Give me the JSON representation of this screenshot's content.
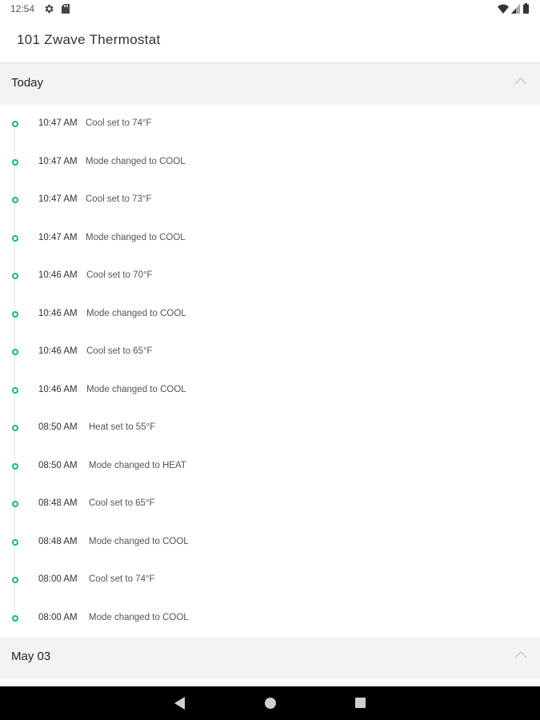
{
  "status_bar": {
    "time": "12:54"
  },
  "header": {
    "title": "101 Zwave Thermostat"
  },
  "sections": [
    {
      "label": "Today"
    },
    {
      "label": "May 03"
    }
  ],
  "events": [
    {
      "time": "10:47 AM",
      "description": "Cool set to 74°F"
    },
    {
      "time": "10:47 AM",
      "description": "Mode changed to COOL"
    },
    {
      "time": "10:47 AM",
      "description": "Cool set to 73°F"
    },
    {
      "time": "10:47 AM",
      "description": "Mode changed to COOL"
    },
    {
      "time": "10:46 AM",
      "description": "Cool set to 70°F"
    },
    {
      "time": "10:46 AM",
      "description": "Mode changed to COOL"
    },
    {
      "time": "10:46 AM",
      "description": "Cool set to 65°F"
    },
    {
      "time": "10:46 AM",
      "description": "Mode changed to COOL"
    },
    {
      "time": "08:50 AM",
      "description": "Heat set to 55°F"
    },
    {
      "time": "08:50 AM",
      "description": "Mode changed to HEAT"
    },
    {
      "time": "08:48 AM",
      "description": "Cool set to 65°F"
    },
    {
      "time": "08:48 AM",
      "description": "Mode changed to COOL"
    },
    {
      "time": "08:00 AM",
      "description": "Cool set to 74°F"
    },
    {
      "time": "08:00 AM",
      "description": "Mode changed to COOL"
    }
  ],
  "colors": {
    "accent": "#1bb673",
    "section_bg": "#f2f3f5"
  },
  "icons": {
    "status": [
      "gear-icon",
      "sd-card-icon",
      "wifi-icon",
      "signal-icon",
      "battery-icon"
    ],
    "section": "chevron-up-icon",
    "nav": [
      "back-icon",
      "home-icon",
      "recents-icon"
    ]
  }
}
